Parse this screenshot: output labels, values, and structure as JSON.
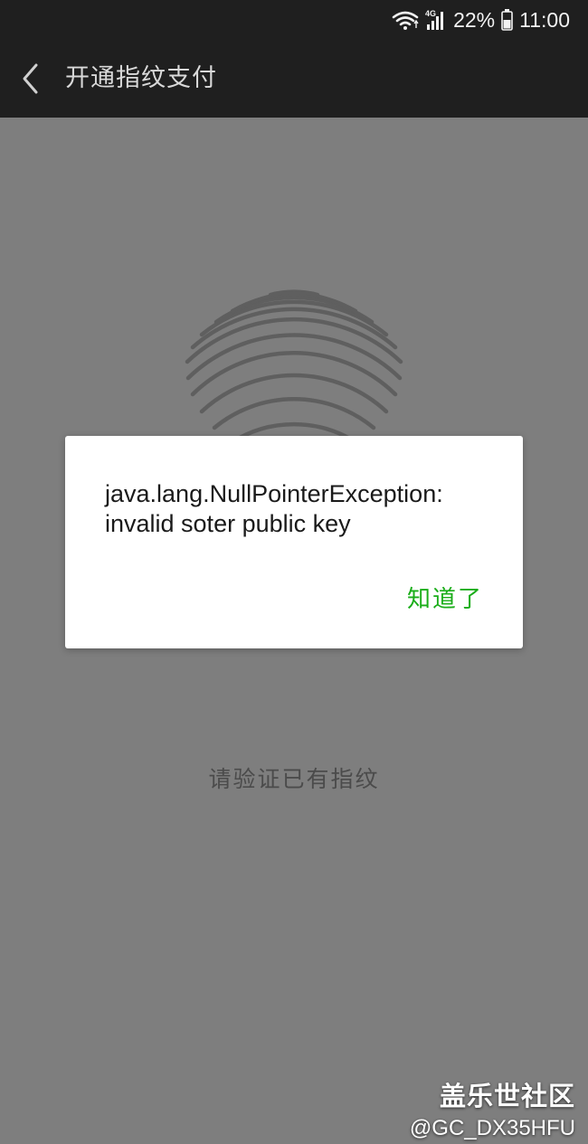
{
  "status_bar": {
    "network": "4G",
    "battery": "22%",
    "time": "11:00",
    "icons": [
      "wifi-icon",
      "signal-icon",
      "battery-icon"
    ]
  },
  "nav": {
    "back_icon": "chevron-left-icon",
    "title": "开通指纹支付"
  },
  "main": {
    "fingerprint_icon": "fingerprint-icon",
    "verify_text": "请验证已有指纹"
  },
  "dialog": {
    "message_line1": "java.lang.NullPointerException:",
    "message_line2": "invalid soter public key",
    "button_label": "知道了"
  },
  "watermark": {
    "title": "盖乐世社区",
    "user": "@GC_DX35HFU"
  },
  "colors": {
    "status_bar_bg": "#1f1f1f",
    "background": "#7e7e7e",
    "accent_green": "#1aad19"
  }
}
